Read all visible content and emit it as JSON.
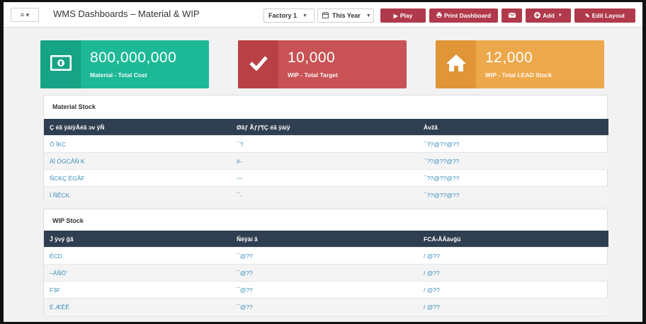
{
  "header": {
    "menu_label": "≡ ▾",
    "title": "WMS Dashboards – Material & WIP",
    "factory_select": "Factory 1",
    "period_select": "This Year",
    "buttons": {
      "play": "Play",
      "print": "Print Dashboard",
      "mail": "",
      "add": "Add",
      "edit": "Edit Layout"
    }
  },
  "kpis": [
    {
      "value": "800,000,000",
      "label": "Material - Total Cost",
      "color": "#1db997",
      "icon_color": "#17a385",
      "icon": "banknote-icon"
    },
    {
      "value": "10,000",
      "label": "WIP - Total Target",
      "color": "#c85255",
      "icon_color": "#b94145",
      "icon": "checkmark-icon"
    },
    {
      "value": "12,000",
      "label": "WIP - Total LEAD Stock",
      "color": "#eea84c",
      "icon_color": "#e09536",
      "icon": "home-icon"
    }
  ],
  "material_stock": {
    "title": "Material Stock",
    "columns": [
      "Ç éã ÿáíÿÅéã ͻv ÿÑ",
      "Øãƒ Ãƒƒ¶Ç éã ÿáíÿ",
      "Àvžã"
    ],
    "rows": [
      [
        "Ö ÎKC",
        "¯?",
        "¯??@??@??"
      ],
      [
        "ÄÏ ÓGCÅÑ K",
        "#-",
        "¯??@??@??"
      ],
      [
        "ÑCKÇ ÉGÂF",
        "—",
        "¯??@??@??"
      ],
      [
        "Í ÑÊCK",
        "¯-",
        "¯??@??@??"
      ]
    ]
  },
  "wip_stock": {
    "title": "WIP Stock",
    "columns": [
      "Ĵ ÿvý ğã",
      "Ñéÿàí ã",
      "FCÁ‹ÅÂàvğü"
    ],
    "rows": [
      [
        "ÉCD",
        "¯@??",
        "/ @??"
      ],
      [
        "–ÀÑÖ'",
        "¯@??",
        "/ @??"
      ],
      [
        "F3F",
        "¯@??",
        "/ @??"
      ],
      [
        "É.ÆÊÊ",
        "¯@??",
        "/ @??"
      ]
    ]
  }
}
